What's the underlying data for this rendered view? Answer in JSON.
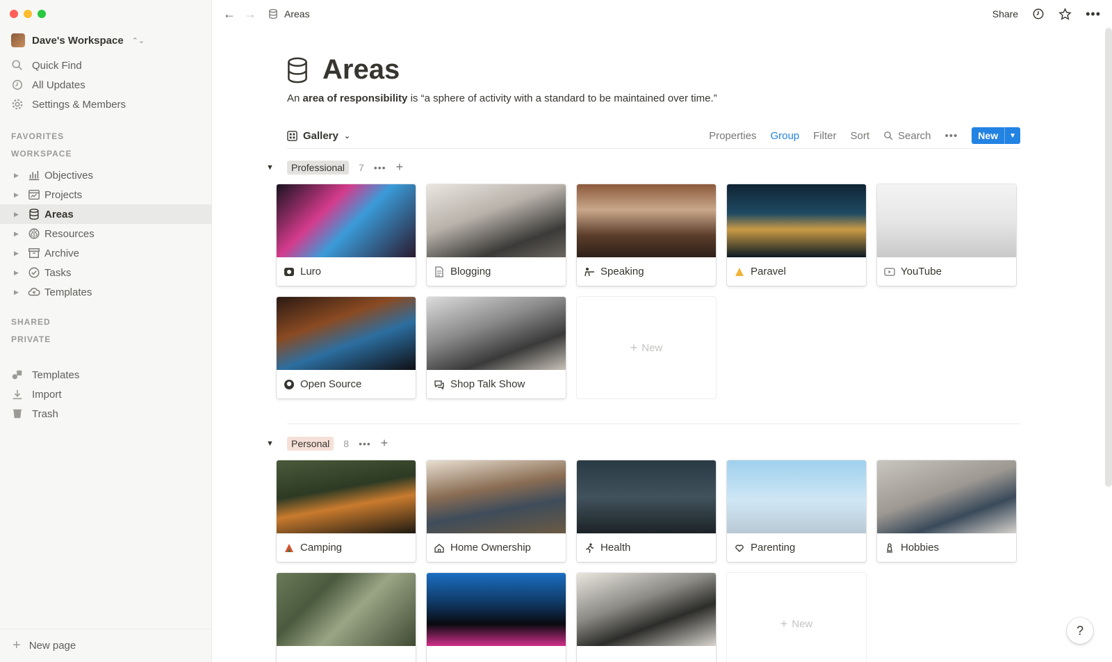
{
  "window": {
    "close_color": "#ff5f57",
    "minimize_color": "#febc2e",
    "zoom_color": "#28c840"
  },
  "sidebar": {
    "workspace": "Dave's Workspace",
    "top_items": [
      {
        "label": "Quick Find",
        "icon": "search-icon"
      },
      {
        "label": "All Updates",
        "icon": "clock-icon"
      },
      {
        "label": "Settings & Members",
        "icon": "gear-icon"
      }
    ],
    "sections": {
      "favorites": "FAVORITES",
      "workspace": "WORKSPACE",
      "shared": "SHARED",
      "private": "PRIVATE"
    },
    "tree": [
      {
        "label": "Objectives",
        "icon": "chart-icon"
      },
      {
        "label": "Projects",
        "icon": "browser-icon"
      },
      {
        "label": "Areas",
        "icon": "database-icon",
        "active": true
      },
      {
        "label": "Resources",
        "icon": "brain-icon"
      },
      {
        "label": "Archive",
        "icon": "archive-icon"
      },
      {
        "label": "Tasks",
        "icon": "check-circle-icon"
      },
      {
        "label": "Templates",
        "icon": "cloud-upload-icon"
      }
    ],
    "bottom_items": [
      {
        "label": "Templates",
        "icon": "shapes-icon"
      },
      {
        "label": "Import",
        "icon": "download-icon"
      },
      {
        "label": "Trash",
        "icon": "trash-icon"
      }
    ],
    "new_page": "New page"
  },
  "topbar": {
    "breadcrumb": "Areas",
    "share": "Share"
  },
  "page": {
    "title": "Areas",
    "desc_prefix": "An ",
    "desc_bold": "area of responsibility",
    "desc_suffix": " is “a sphere of activity with a standard to be maintained over time.”"
  },
  "view": {
    "tab": "Gallery",
    "tools": {
      "properties": "Properties",
      "group": "Group",
      "filter": "Filter",
      "sort": "Sort",
      "search": "Search",
      "new": "New"
    },
    "accent": "#2383e2"
  },
  "groups": [
    {
      "name": "Professional",
      "count": "7",
      "pill_color": "#e3e2e0",
      "cards": [
        {
          "label": "Luro",
          "icon": "luro-logo-icon",
          "img": "linear-gradient(135deg,#1a1320 0%,#d43b8c 35%,#3a9bd8 55%,#2a1a2e 100%)"
        },
        {
          "label": "Blogging",
          "icon": "document-icon",
          "img": "linear-gradient(160deg,#eae6e0 0%,#b8b2aa 40%,#3b3a38 75%,#6a6560 100%)"
        },
        {
          "label": "Speaking",
          "icon": "presenter-icon",
          "img": "linear-gradient(180deg,#8c5a3c 0%,#c9a78a 35%,#5b3d2b 70%,#2e2019 100%)"
        },
        {
          "label": "Paravel",
          "icon": "triangle-icon",
          "img": "linear-gradient(180deg,#0f2433 0%,#1f4a63 40%,#c99a45 62%,#0c1a22 100%)"
        },
        {
          "label": "YouTube",
          "icon": "play-icon",
          "img": "linear-gradient(180deg,#f4f4f4 0%,#e6e6e6 50%,#c9c9c9 100%)"
        },
        {
          "label": "Open Source",
          "icon": "github-icon",
          "img": "linear-gradient(160deg,#2b1a14 0%,#8a4a22 35%,#2c6ea0 60%,#0f0f14 100%)"
        },
        {
          "label": "Shop Talk Show",
          "icon": "chat-icon",
          "img": "linear-gradient(160deg,#dcdcdc 0%,#8a8a8a 40%,#3a3a3a 70%,#c8c2b8 100%)"
        }
      ]
    },
    {
      "name": "Personal",
      "count": "8",
      "pill_color": "#f5e0d8",
      "cards": [
        {
          "label": "Camping",
          "icon": "tent-icon",
          "img": "linear-gradient(170deg,#4a5a3a 0%,#2d3a24 40%,#c97b2e 60%,#1f1a12 100%)"
        },
        {
          "label": "Home Ownership",
          "icon": "house-icon",
          "img": "linear-gradient(170deg,#e8dfd1 0%,#8a6d54 40%,#3e4c5a 65%,#6b5a44 100%)"
        },
        {
          "label": "Health",
          "icon": "runner-icon",
          "img": "linear-gradient(180deg,#2a3a44 0%,#42525c 50%,#1c2328 100%)"
        },
        {
          "label": "Parenting",
          "icon": "heart-hand-icon",
          "img": "linear-gradient(180deg,#9fd0ee 0%,#cfe7f5 55%,#b8c9d4 100%)"
        },
        {
          "label": "Hobbies",
          "icon": "chess-icon",
          "img": "linear-gradient(160deg,#c9c5bf 0%,#9d9892 45%,#3a4a5a 70%,#d6d2cc 100%)"
        },
        {
          "label": "",
          "icon": "",
          "img": "linear-gradient(135deg,#6a7a58 0%,#4b5a3e 30%,#9aa585 55%,#3f4a34 100%)"
        },
        {
          "label": "",
          "icon": "",
          "img": "linear-gradient(180deg,#1a6ec2 0%,#0f3a66 40%,#0a0a10 70%,#d12f8a 100%)"
        },
        {
          "label": "",
          "icon": "",
          "img": "linear-gradient(160deg,#e9e6df 0%,#8b8a84 40%,#2c2c2a 65%,#d9d6cf 100%)"
        }
      ]
    }
  ],
  "new_card_label": "New",
  "help": "?"
}
